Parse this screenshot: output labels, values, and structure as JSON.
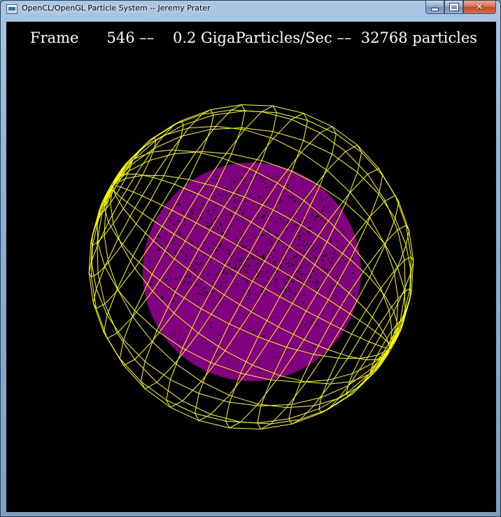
{
  "window": {
    "title": "OpenCL/OpenGL Particle System -- Jeremy Prater",
    "icon": "app-window-icon",
    "controls": {
      "minimize": "minimize-icon",
      "maximize": "maximize-icon",
      "close": "close-icon"
    }
  },
  "hud": {
    "text": "Frame      546 ––    0.2 GigaParticles/Sec ––  32768 particles"
  },
  "scene": {
    "colors": {
      "wireframe": "#ffff00",
      "particles": "#800080",
      "background": "#000000"
    }
  }
}
